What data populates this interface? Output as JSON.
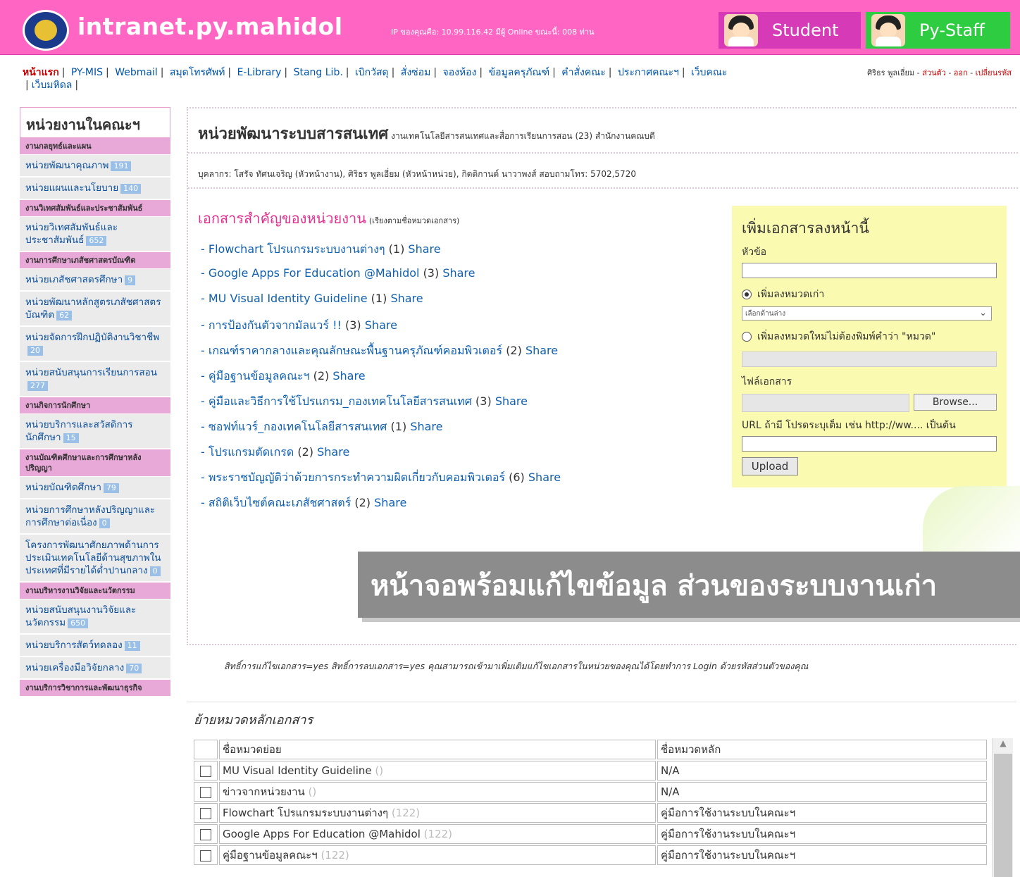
{
  "header": {
    "site_title": "intranet.py.mahidol",
    "ip_info": "IP ของคุณคือ: 10.99.116.42 มีผู้ Online ขณะนี้: 008 ท่าน",
    "student_label": "Student",
    "staff_label": "Py-Staff",
    "colors": {
      "bar": "#ff66c4",
      "student": "#d63ab6",
      "staff": "#2ecc40"
    }
  },
  "topnav": {
    "items": [
      "หน้าแรก",
      "PY-MIS",
      "Webmail",
      "สมุดโทรศัพท์",
      "E-Library",
      "Stang Lib.",
      "เบิกวัสดุ",
      "สั่งซ่อม",
      "จองห้อง",
      "ข้อมูลครุภัณฑ์",
      "คำสั่งคณะ",
      "ประกาศคณะฯ",
      "เว็บคณะ",
      "เว็บมหิดล"
    ],
    "user_name": "ศิริธร พูลเอี่ยม",
    "user_links": [
      "ส่วนตัว",
      "ออก",
      "เปลี่ยนรหัส"
    ]
  },
  "sidebar": {
    "title": "หน่วยงานในคณะฯ",
    "entries": [
      {
        "type": "group",
        "label": "งานกลยุทธ์และแผน"
      },
      {
        "type": "item",
        "label": "หน่วยพัฒนาคุณภาพ",
        "count": "191"
      },
      {
        "type": "item",
        "label": "หน่วยแผนและนโยบาย",
        "count": "140"
      },
      {
        "type": "group",
        "label": "งานวิเทศสัมพันธ์และประชาสัมพันธ์"
      },
      {
        "type": "item",
        "label": "หน่วยวิเทศสัมพันธ์และประชาสัมพันธ์",
        "count": "652"
      },
      {
        "type": "group",
        "label": "งานการศึกษาเภสัชศาสตรบัณฑิต"
      },
      {
        "type": "item",
        "label": "หน่วยเภสัชศาสตรศึกษา",
        "count": "9"
      },
      {
        "type": "item",
        "label": "หน่วยพัฒนาหลักสูตรเภสัชศาสตรบัณฑิต",
        "count": "62"
      },
      {
        "type": "item",
        "label": "หน่วยจัดการฝึกปฏิบัติงานวิชาชีพ",
        "count": "20"
      },
      {
        "type": "item",
        "label": "หน่วยสนับสนุนการเรียนการสอน",
        "count": "277"
      },
      {
        "type": "group",
        "label": "งานกิจการนักศึกษา"
      },
      {
        "type": "item",
        "label": "หน่วยบริการและสวัสดิการนักศึกษา",
        "count": "15"
      },
      {
        "type": "group",
        "label": "งานบัณฑิตศึกษาและการศึกษาหลังปริญญา"
      },
      {
        "type": "item",
        "label": "หน่วยบัณฑิตศึกษา",
        "count": "79"
      },
      {
        "type": "item",
        "label": "หน่วยการศึกษาหลังปริญญาและการศึกษาต่อเนื่อง",
        "count": "0"
      },
      {
        "type": "item",
        "label": "โครงการพัฒนาศักยภาพด้านการประเมินเทคโนโลยีด้านสุขภาพในประเทศที่มีรายได้ต่ำปานกลาง",
        "count": "0"
      },
      {
        "type": "group",
        "label": "งานบริหารงานวิจัยและนวัตกรรม"
      },
      {
        "type": "item",
        "label": "หน่วยสนับสนุนงานวิจัยและนวัตกรรม",
        "count": "650"
      },
      {
        "type": "item",
        "label": "หน่วยบริการสัตว์ทดลอง",
        "count": "11"
      },
      {
        "type": "item",
        "label": "หน่วยเครื่องมือวิจัยกลาง",
        "count": "70"
      },
      {
        "type": "group",
        "label": "งานบริการวิชาการและพัฒนาธุรกิจ"
      }
    ]
  },
  "main": {
    "title": "หน่วยพัฒนาระบบสารสนเทศ",
    "subtitle": "งานเทคโนโลยีสารสนเทศและสื่อการเรียนการสอน (23) สำนักงานคณบดี",
    "staff_line": "บุคลากร: โสรัจ ทัศนเจริญ (หัวหน้างาน),  ศิริธร พูลเอี่ยม (หัวหน้าหน่วย),  กิตติกานต์ นาวาพงส์   สอบถามโทร: 5702,5720",
    "docs_title": "เอกสารสำคัญของหน่วยงาน",
    "docs_sort_note": "(เรียงตามชื่อหมวดเอกสาร)",
    "share_label": "Share",
    "documents": [
      {
        "name": "- Flowchart โปรแกรมระบบงานต่างๆ",
        "count": "(1)"
      },
      {
        "name": "- Google Apps For Education @Mahidol",
        "count": "(3)"
      },
      {
        "name": "- MU Visual Identity Guideline",
        "count": "(1)"
      },
      {
        "name": "- การป้องกันตัวจากมัลแวร์ !!",
        "count": "(3)"
      },
      {
        "name": "- เกณฑ์ราคากลางและคุณลักษณะพื้นฐานครุภัณฑ์คอมพิวเตอร์",
        "count": "(2)"
      },
      {
        "name": "- คู่มือฐานข้อมูลคณะฯ",
        "count": "(2)"
      },
      {
        "name": "- คู่มือและวิธีการใช้โปรแกรม_กองเทคโนโลยีสารสนเทศ",
        "count": "(3)"
      },
      {
        "name": "- ซอฟท์แวร์_กองเทคโนโลยีสารสนเทศ",
        "count": "(1)"
      },
      {
        "name": "- โปรแกรมตัดเกรด",
        "count": "(2)"
      },
      {
        "name": "- พระราชบัญญัติว่าด้วยการกระทำความผิดเกี่ยวกับคอมพิวเตอร์",
        "count": "(6)"
      },
      {
        "name": "- สถิติเว็บไซต์คณะเภสัชศาสตร์",
        "count": "(2)"
      }
    ]
  },
  "upload": {
    "title": "เพิ่มเอกสารลงหน้านี้",
    "subject_label": "หัวข้อ",
    "radio_existing": "เพิ่มลงหมวดเก่า",
    "select_value": "เลือกด้านล่าง",
    "radio_new": "เพิ่มลงหมวดใหม่ไม่ต้องพิมพ์คำว่า \"หมวด\"",
    "file_label": "ไฟล์เอกสาร",
    "browse_label": "Browse...",
    "url_label": "URL ถ้ามี โปรดระบุเต็ม เช่น http://ww.... เป็นต้น",
    "upload_label": "Upload"
  },
  "banner": {
    "text": "หน้าจอพร้อมแก้ไขข้อมูล ส่วนของระบบงานเก่า"
  },
  "rights_text": "สิทธิ์การแก้ไขเอกสาร=yes สิทธิ์การลบเอกสาร=yes   คุณสามารถเข้ามาเพิ่มเติมแก้ไขเอกสารในหน่วยของคุณได้โดยทำการ Login ด้วยรหัสส่วนตัวของคุณ",
  "move_section": {
    "title": "ย้ายหมวดหลักเอกสาร",
    "col_sub": "ชื่อหมวดย่อย",
    "col_main": "ชื่อหมวดหลัก",
    "rows": [
      {
        "sub": "MU Visual Identity Guideline",
        "sub_count": "()",
        "main": "N/A"
      },
      {
        "sub": "ข่าวจากหน่วยงาน",
        "sub_count": "()",
        "main": "N/A"
      },
      {
        "sub": "Flowchart โปรแกรมระบบงานต่างๆ",
        "sub_count": "(122)",
        "main": "คู่มือการใช้งานระบบในคณะฯ"
      },
      {
        "sub": "Google Apps For Education @Mahidol",
        "sub_count": "(122)",
        "main": "คู่มือการใช้งานระบบในคณะฯ"
      },
      {
        "sub": "คู่มือฐานข้อมูลคณะฯ",
        "sub_count": "(122)",
        "main": "คู่มือการใช้งานระบบในคณะฯ"
      }
    ]
  }
}
